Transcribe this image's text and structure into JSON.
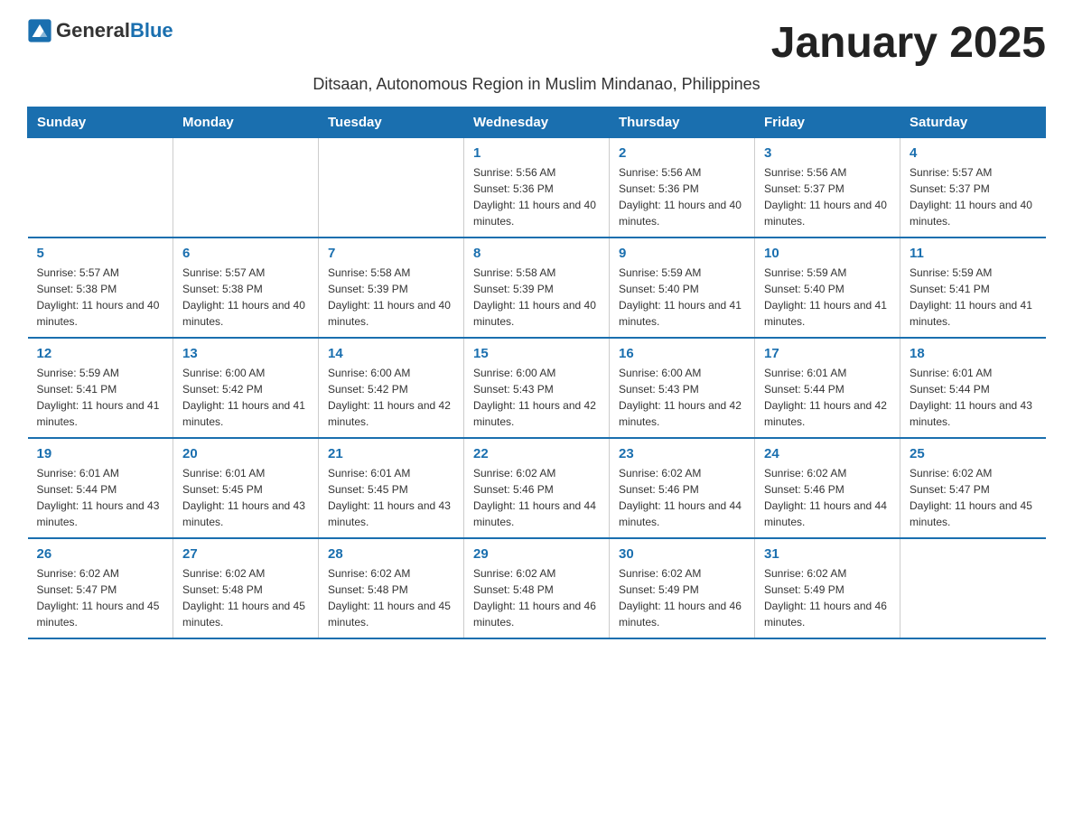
{
  "logo": {
    "general": "General",
    "blue": "Blue"
  },
  "title": "January 2025",
  "subtitle": "Ditsaan, Autonomous Region in Muslim Mindanao, Philippines",
  "weekdays": [
    "Sunday",
    "Monday",
    "Tuesday",
    "Wednesday",
    "Thursday",
    "Friday",
    "Saturday"
  ],
  "weeks": [
    [
      {
        "day": "",
        "info": ""
      },
      {
        "day": "",
        "info": ""
      },
      {
        "day": "",
        "info": ""
      },
      {
        "day": "1",
        "info": "Sunrise: 5:56 AM\nSunset: 5:36 PM\nDaylight: 11 hours and 40 minutes."
      },
      {
        "day": "2",
        "info": "Sunrise: 5:56 AM\nSunset: 5:36 PM\nDaylight: 11 hours and 40 minutes."
      },
      {
        "day": "3",
        "info": "Sunrise: 5:56 AM\nSunset: 5:37 PM\nDaylight: 11 hours and 40 minutes."
      },
      {
        "day": "4",
        "info": "Sunrise: 5:57 AM\nSunset: 5:37 PM\nDaylight: 11 hours and 40 minutes."
      }
    ],
    [
      {
        "day": "5",
        "info": "Sunrise: 5:57 AM\nSunset: 5:38 PM\nDaylight: 11 hours and 40 minutes."
      },
      {
        "day": "6",
        "info": "Sunrise: 5:57 AM\nSunset: 5:38 PM\nDaylight: 11 hours and 40 minutes."
      },
      {
        "day": "7",
        "info": "Sunrise: 5:58 AM\nSunset: 5:39 PM\nDaylight: 11 hours and 40 minutes."
      },
      {
        "day": "8",
        "info": "Sunrise: 5:58 AM\nSunset: 5:39 PM\nDaylight: 11 hours and 40 minutes."
      },
      {
        "day": "9",
        "info": "Sunrise: 5:59 AM\nSunset: 5:40 PM\nDaylight: 11 hours and 41 minutes."
      },
      {
        "day": "10",
        "info": "Sunrise: 5:59 AM\nSunset: 5:40 PM\nDaylight: 11 hours and 41 minutes."
      },
      {
        "day": "11",
        "info": "Sunrise: 5:59 AM\nSunset: 5:41 PM\nDaylight: 11 hours and 41 minutes."
      }
    ],
    [
      {
        "day": "12",
        "info": "Sunrise: 5:59 AM\nSunset: 5:41 PM\nDaylight: 11 hours and 41 minutes."
      },
      {
        "day": "13",
        "info": "Sunrise: 6:00 AM\nSunset: 5:42 PM\nDaylight: 11 hours and 41 minutes."
      },
      {
        "day": "14",
        "info": "Sunrise: 6:00 AM\nSunset: 5:42 PM\nDaylight: 11 hours and 42 minutes."
      },
      {
        "day": "15",
        "info": "Sunrise: 6:00 AM\nSunset: 5:43 PM\nDaylight: 11 hours and 42 minutes."
      },
      {
        "day": "16",
        "info": "Sunrise: 6:00 AM\nSunset: 5:43 PM\nDaylight: 11 hours and 42 minutes."
      },
      {
        "day": "17",
        "info": "Sunrise: 6:01 AM\nSunset: 5:44 PM\nDaylight: 11 hours and 42 minutes."
      },
      {
        "day": "18",
        "info": "Sunrise: 6:01 AM\nSunset: 5:44 PM\nDaylight: 11 hours and 43 minutes."
      }
    ],
    [
      {
        "day": "19",
        "info": "Sunrise: 6:01 AM\nSunset: 5:44 PM\nDaylight: 11 hours and 43 minutes."
      },
      {
        "day": "20",
        "info": "Sunrise: 6:01 AM\nSunset: 5:45 PM\nDaylight: 11 hours and 43 minutes."
      },
      {
        "day": "21",
        "info": "Sunrise: 6:01 AM\nSunset: 5:45 PM\nDaylight: 11 hours and 43 minutes."
      },
      {
        "day": "22",
        "info": "Sunrise: 6:02 AM\nSunset: 5:46 PM\nDaylight: 11 hours and 44 minutes."
      },
      {
        "day": "23",
        "info": "Sunrise: 6:02 AM\nSunset: 5:46 PM\nDaylight: 11 hours and 44 minutes."
      },
      {
        "day": "24",
        "info": "Sunrise: 6:02 AM\nSunset: 5:46 PM\nDaylight: 11 hours and 44 minutes."
      },
      {
        "day": "25",
        "info": "Sunrise: 6:02 AM\nSunset: 5:47 PM\nDaylight: 11 hours and 45 minutes."
      }
    ],
    [
      {
        "day": "26",
        "info": "Sunrise: 6:02 AM\nSunset: 5:47 PM\nDaylight: 11 hours and 45 minutes."
      },
      {
        "day": "27",
        "info": "Sunrise: 6:02 AM\nSunset: 5:48 PM\nDaylight: 11 hours and 45 minutes."
      },
      {
        "day": "28",
        "info": "Sunrise: 6:02 AM\nSunset: 5:48 PM\nDaylight: 11 hours and 45 minutes."
      },
      {
        "day": "29",
        "info": "Sunrise: 6:02 AM\nSunset: 5:48 PM\nDaylight: 11 hours and 46 minutes."
      },
      {
        "day": "30",
        "info": "Sunrise: 6:02 AM\nSunset: 5:49 PM\nDaylight: 11 hours and 46 minutes."
      },
      {
        "day": "31",
        "info": "Sunrise: 6:02 AM\nSunset: 5:49 PM\nDaylight: 11 hours and 46 minutes."
      },
      {
        "day": "",
        "info": ""
      }
    ]
  ]
}
